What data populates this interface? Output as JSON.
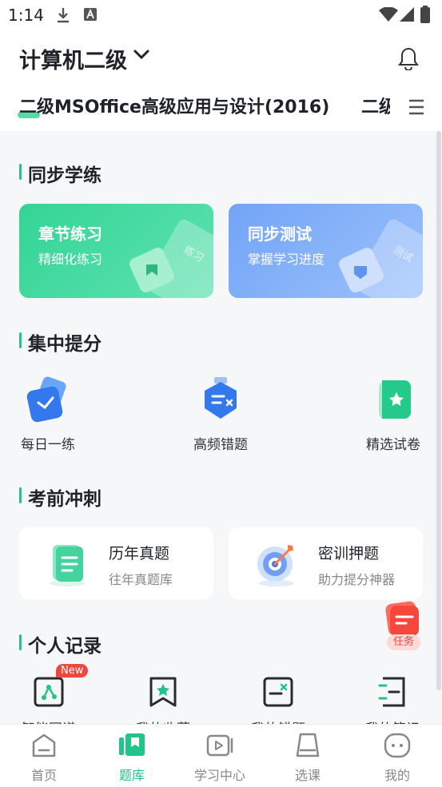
{
  "status_bar": {
    "time": "1:14"
  },
  "header": {
    "exam_name": "计算机二级",
    "subject_tabs": [
      "二级MSOffice高级应用与设计(2016)",
      "二级"
    ]
  },
  "sections": {
    "sync": {
      "title": "同步学练",
      "cards": [
        {
          "title": "章节练习",
          "subtitle": "精细化练习",
          "deco_text": "练习"
        },
        {
          "title": "同步测试",
          "subtitle": "掌握学习进度",
          "deco_text": "测试"
        }
      ]
    },
    "focus": {
      "title": "集中提分",
      "items": [
        {
          "label": "每日一练"
        },
        {
          "label": "高频错题"
        },
        {
          "label": "精选试卷"
        }
      ]
    },
    "sprint": {
      "title": "考前冲刺",
      "cards": [
        {
          "title": "历年真题",
          "subtitle": "往年真题库"
        },
        {
          "title": "密训押题",
          "subtitle": "助力提分神器"
        }
      ]
    },
    "records": {
      "title": "个人记录",
      "badge": "New",
      "items": [
        {
          "label": "智能图谱"
        },
        {
          "label": "我的收藏"
        },
        {
          "label": "我的错题"
        },
        {
          "label": "我的笔记"
        }
      ]
    }
  },
  "task_button": {
    "label": "任务"
  },
  "tab_bar": {
    "active": "题库",
    "tabs": [
      {
        "label": "首页"
      },
      {
        "label": "题库"
      },
      {
        "label": "学习中心"
      },
      {
        "label": "选课"
      },
      {
        "label": "我的"
      }
    ]
  },
  "colors": {
    "accent": "#20c587",
    "green_card": "#33d496",
    "blue_card": "#72a4f7",
    "badge_red": "#f0463c"
  }
}
